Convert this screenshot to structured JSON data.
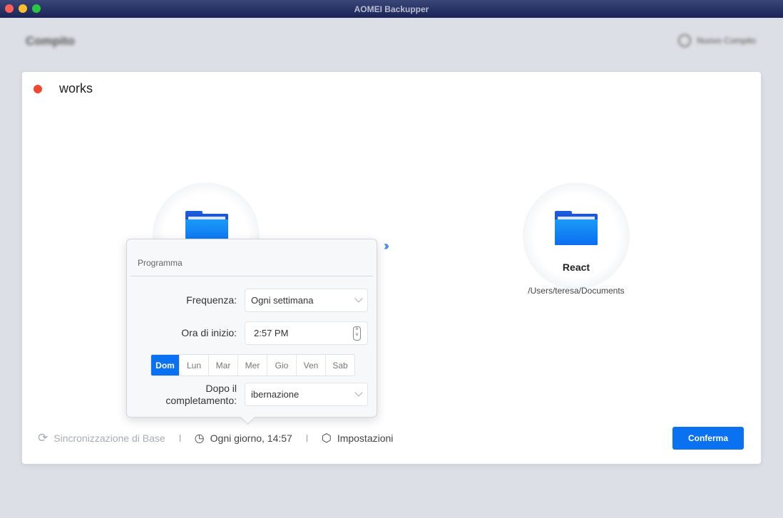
{
  "window": {
    "title": "AOMEI Backupper"
  },
  "background": {
    "title": "Compito",
    "new_task": "Nuovo Compito"
  },
  "task": {
    "name": "works",
    "status_color": "#f2472f"
  },
  "destination": {
    "name": "React",
    "path": "/Users/teresa/Documents"
  },
  "bottom": {
    "sync_mode": "Sincronizzazione di Base",
    "schedule": "Ogni giorno, 14:57",
    "settings": "Impostazioni",
    "confirm": "Conferma"
  },
  "popover": {
    "title": "Programma",
    "frequency_label": "Frequenza:",
    "frequency_value": "Ogni settimana",
    "start_label": "Ora di inizio:",
    "start_value": "2:57 PM",
    "days": [
      "Dom",
      "Lun",
      "Mar",
      "Mer",
      "Gio",
      "Ven",
      "Sab"
    ],
    "selected_day": "Dom",
    "after_label_1": "Dopo il",
    "after_label_2": "completamento:",
    "after_value": "ibernazione"
  }
}
